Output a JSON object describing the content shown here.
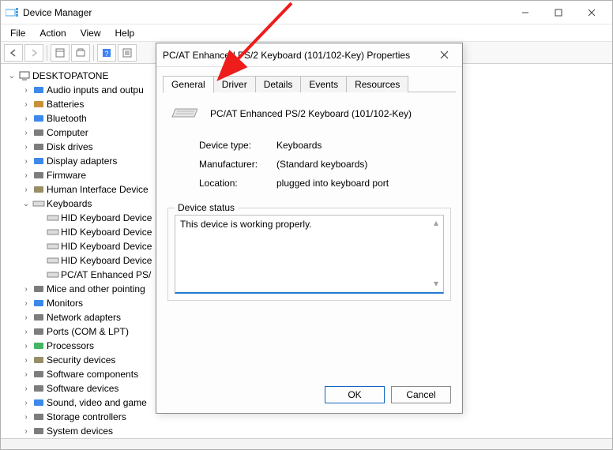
{
  "window": {
    "title": "Device Manager"
  },
  "menus": [
    "File",
    "Action",
    "View",
    "Help"
  ],
  "root": "DESKTOPATONE",
  "tree": [
    {
      "icon": "audio",
      "color": "#1a73e8",
      "label": "Audio inputs and outpu"
    },
    {
      "icon": "battery",
      "color": "#c07d14",
      "label": "Batteries"
    },
    {
      "icon": "bt",
      "color": "#1a73e8",
      "label": "Bluetooth"
    },
    {
      "icon": "computer",
      "color": "#666",
      "label": "Computer"
    },
    {
      "icon": "disk",
      "color": "#666",
      "label": "Disk drives"
    },
    {
      "icon": "display",
      "color": "#1a73e8",
      "label": "Display adapters"
    },
    {
      "icon": "firmware",
      "color": "#666",
      "label": "Firmware"
    },
    {
      "icon": "hid",
      "color": "#867a4a",
      "label": "Human Interface Device"
    }
  ],
  "keyboards_label": "Keyboards",
  "keyboards": [
    "HID Keyboard Device",
    "HID Keyboard Device",
    "HID Keyboard Device",
    "HID Keyboard Device",
    "PC/AT Enhanced PS/"
  ],
  "tree2": [
    {
      "icon": "mouse",
      "color": "#666",
      "label": "Mice and other pointing"
    },
    {
      "icon": "monitor",
      "color": "#1a73e8",
      "label": "Monitors"
    },
    {
      "icon": "network",
      "color": "#666",
      "label": "Network adapters"
    },
    {
      "icon": "port",
      "color": "#666",
      "label": "Ports (COM & LPT)"
    },
    {
      "icon": "cpu",
      "color": "#23a846",
      "label": "Processors"
    },
    {
      "icon": "security",
      "color": "#867a4a",
      "label": "Security devices"
    },
    {
      "icon": "swcomp",
      "color": "#666",
      "label": "Software components"
    },
    {
      "icon": "swdev",
      "color": "#666",
      "label": "Software devices"
    },
    {
      "icon": "sound",
      "color": "#1a73e8",
      "label": "Sound, video and game"
    },
    {
      "icon": "storage",
      "color": "#666",
      "label": "Storage controllers"
    },
    {
      "icon": "system",
      "color": "#666",
      "label": "System devices"
    }
  ],
  "dialog": {
    "title": "PC/AT Enhanced PS/2 Keyboard (101/102-Key) Properties",
    "tabs": [
      "General",
      "Driver",
      "Details",
      "Events",
      "Resources"
    ],
    "device_name": "PC/AT Enhanced PS/2 Keyboard (101/102-Key)",
    "props": {
      "type_label": "Device type:",
      "type": "Keyboards",
      "mfr_label": "Manufacturer:",
      "mfr": "(Standard keyboards)",
      "loc_label": "Location:",
      "loc": "plugged into keyboard port"
    },
    "status_legend": "Device status",
    "status_text": "This device is working properly.",
    "ok": "OK",
    "cancel": "Cancel"
  }
}
